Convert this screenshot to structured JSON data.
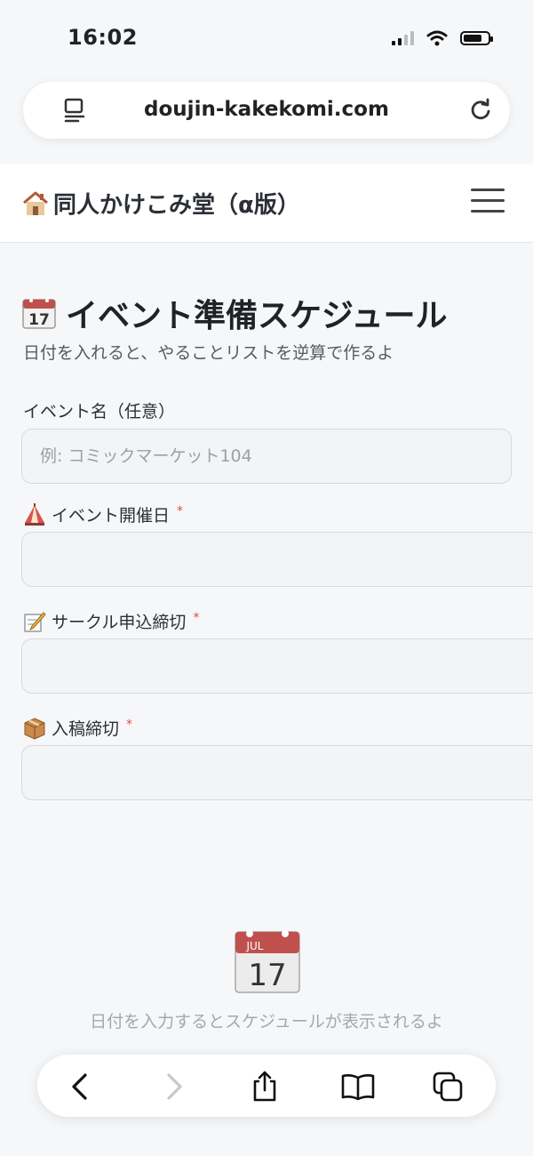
{
  "status_bar": {
    "time": "16:02",
    "signal_icon": "signal-icon",
    "wifi_icon": "wifi-icon",
    "battery_icon": "battery-icon",
    "battery_level": 0.75
  },
  "browser": {
    "url": "doujin-kakekomi.com",
    "reader_icon": "reader-icon",
    "reload_icon": "reload-icon"
  },
  "site": {
    "title": "同人かけこみ堂（α版）",
    "logo_icon": "house-icon",
    "menu_icon": "hamburger-menu-icon"
  },
  "page": {
    "title": "イベント準備スケジュール",
    "title_icon": "calendar-icon",
    "calendar_day": "17",
    "subtitle": "日付を入れると、やることリストを逆算で作るよ"
  },
  "form": {
    "event_name": {
      "label": "イベント名（任意）",
      "placeholder": "例: コミックマーケット104",
      "value": ""
    },
    "event_date": {
      "label": "イベント開催日",
      "required_mark": "*",
      "icon": "circus-tent-icon",
      "value": ""
    },
    "circle_deadline": {
      "label": "サークル申込締切",
      "required_mark": "*",
      "icon": "memo-icon",
      "value": ""
    },
    "submission_deadline": {
      "label": "入稿締切",
      "required_mark": "*",
      "icon": "package-icon",
      "value": ""
    }
  },
  "empty_state": {
    "icon": "calendar-icon",
    "month": "JUL",
    "day": "17",
    "text": "日付を入力するとスケジュールが表示されるよ"
  },
  "toolbar": {
    "back_icon": "back-icon",
    "forward_icon": "forward-icon",
    "share_icon": "share-icon",
    "bookmarks_icon": "bookmarks-icon",
    "tabs_icon": "tabs-icon"
  },
  "colors": {
    "required": "#e5484d",
    "calendar_red": "#c0504d",
    "background": "#f6f7f9"
  }
}
